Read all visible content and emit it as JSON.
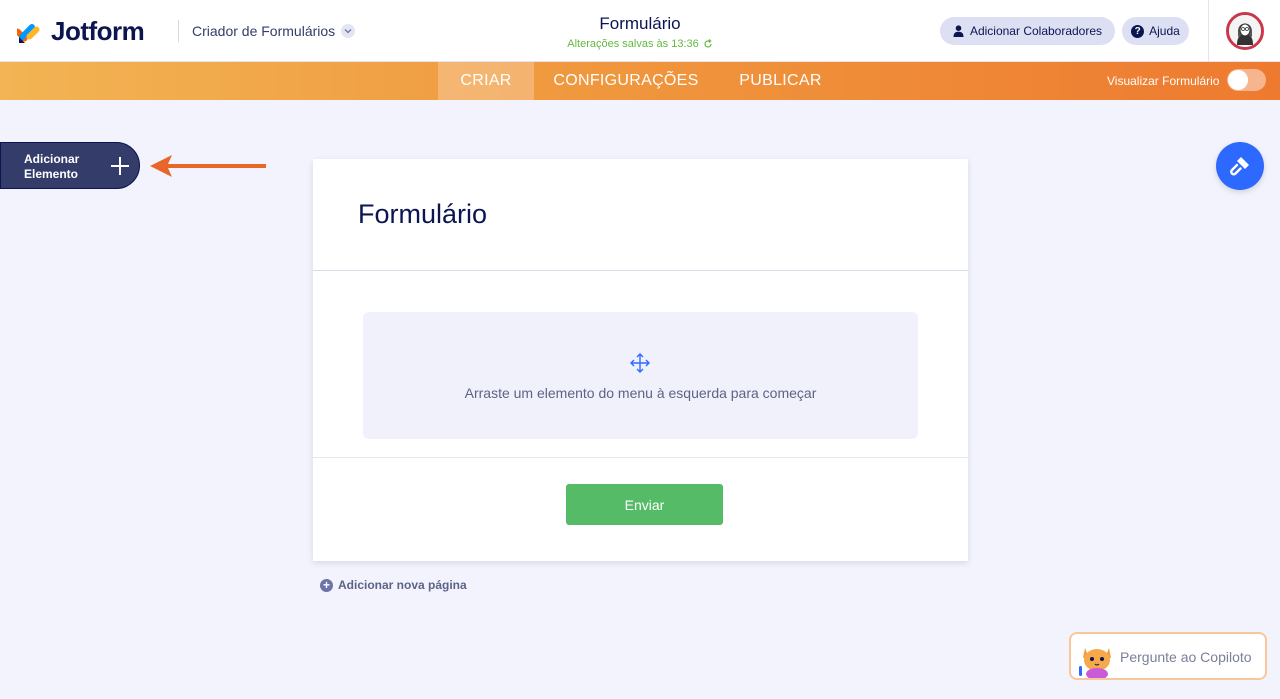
{
  "header": {
    "logo_text": "Jotform",
    "builder_title": "Criador de Formulários",
    "form_title": "Formulário",
    "saved_status": "Alterações salvas às 13:36",
    "collaborators_label": "Adicionar Colaboradores",
    "help_label": "Ajuda"
  },
  "nav": {
    "tabs": [
      {
        "label": "CRIAR",
        "active": true
      },
      {
        "label": "CONFIGURAÇÕES",
        "active": false
      },
      {
        "label": "PUBLICAR",
        "active": false
      }
    ],
    "preview_label": "Visualizar Formulário",
    "preview_enabled": false
  },
  "sidebar": {
    "add_element_label": "Adicionar Elemento"
  },
  "form": {
    "heading": "Formulário",
    "drop_hint": "Arraste um elemento do menu à esquerda para começar",
    "submit_label": "Enviar"
  },
  "add_page_label": "Adicionar nova página",
  "copilot": {
    "label": "Pergunte ao Copiloto"
  },
  "colors": {
    "accent_orange": "#f0983e",
    "primary_navy": "#0a1551",
    "submit_green": "#56bb66",
    "designer_blue": "#2e69ff",
    "annotation_arrow": "#e8662a"
  }
}
